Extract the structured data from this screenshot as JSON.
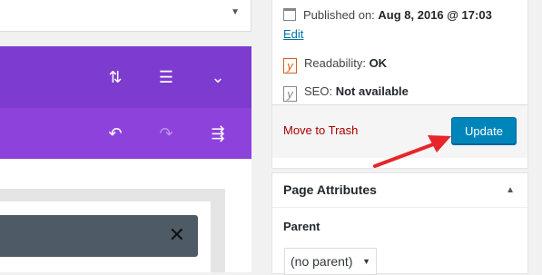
{
  "editor": {
    "icons": {
      "dropdown": "triangle-down-icon",
      "sort": "sort-arrows-icon",
      "menu": "hamburger-icon",
      "collapse": "chevron-down-icon",
      "undo": "undo-icon",
      "redo": "redo-icon",
      "history": "history-icon",
      "close": "close-icon"
    },
    "colors": {
      "purple_primary": "#7e3bd0",
      "purple_secondary": "#8e42dc",
      "dark_bar": "#4e5a65"
    }
  },
  "publish": {
    "published_label": "Published on:",
    "published_value": "Aug 8, 2016 @ 17:03",
    "edit_label": "Edit",
    "readability_label": "Readability:",
    "readability_value": "OK",
    "seo_label": "SEO:",
    "seo_value": "Not available",
    "trash_label": "Move to Trash",
    "update_label": "Update",
    "yoast_glyph": "y"
  },
  "page_attributes": {
    "title": "Page Attributes",
    "parent_label": "Parent",
    "parent_value": "(no parent)"
  },
  "colors": {
    "update_button": "#0085ba",
    "trash_link": "#a00",
    "edit_link": "#0073aa",
    "annotation_arrow": "#e8252a"
  }
}
